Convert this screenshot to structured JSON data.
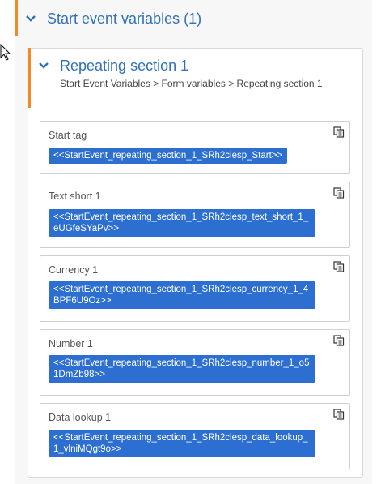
{
  "outer_section": {
    "title": "Start event variables (1)"
  },
  "inner_section": {
    "title": "Repeating section 1",
    "breadcrumb": "Start Event Variables > Form variables > Repeating section 1"
  },
  "cards": [
    {
      "label": "Start tag",
      "value": "<<StartEvent_repeating_section_1_SRh2clesp_Start>>"
    },
    {
      "label": "Text short 1",
      "value": "<<StartEvent_repeating_section_1_SRh2clesp_text_short_1_eUGfeSYaPv>>"
    },
    {
      "label": "Currency 1",
      "value": "<<StartEvent_repeating_section_1_SRh2clesp_currency_1_4BPF6U9Oz>>"
    },
    {
      "label": "Number 1",
      "value": "<<StartEvent_repeating_section_1_SRh2clesp_number_1_o51DmZb98>>"
    },
    {
      "label": "Data lookup 1",
      "value": "<<StartEvent_repeating_section_1_SRh2clesp_data_lookup_1_vlniMQgt9o>>"
    }
  ],
  "colors": {
    "accent": "#f08a24",
    "title": "#2f6fb8",
    "chip": "#2d6fd0"
  }
}
